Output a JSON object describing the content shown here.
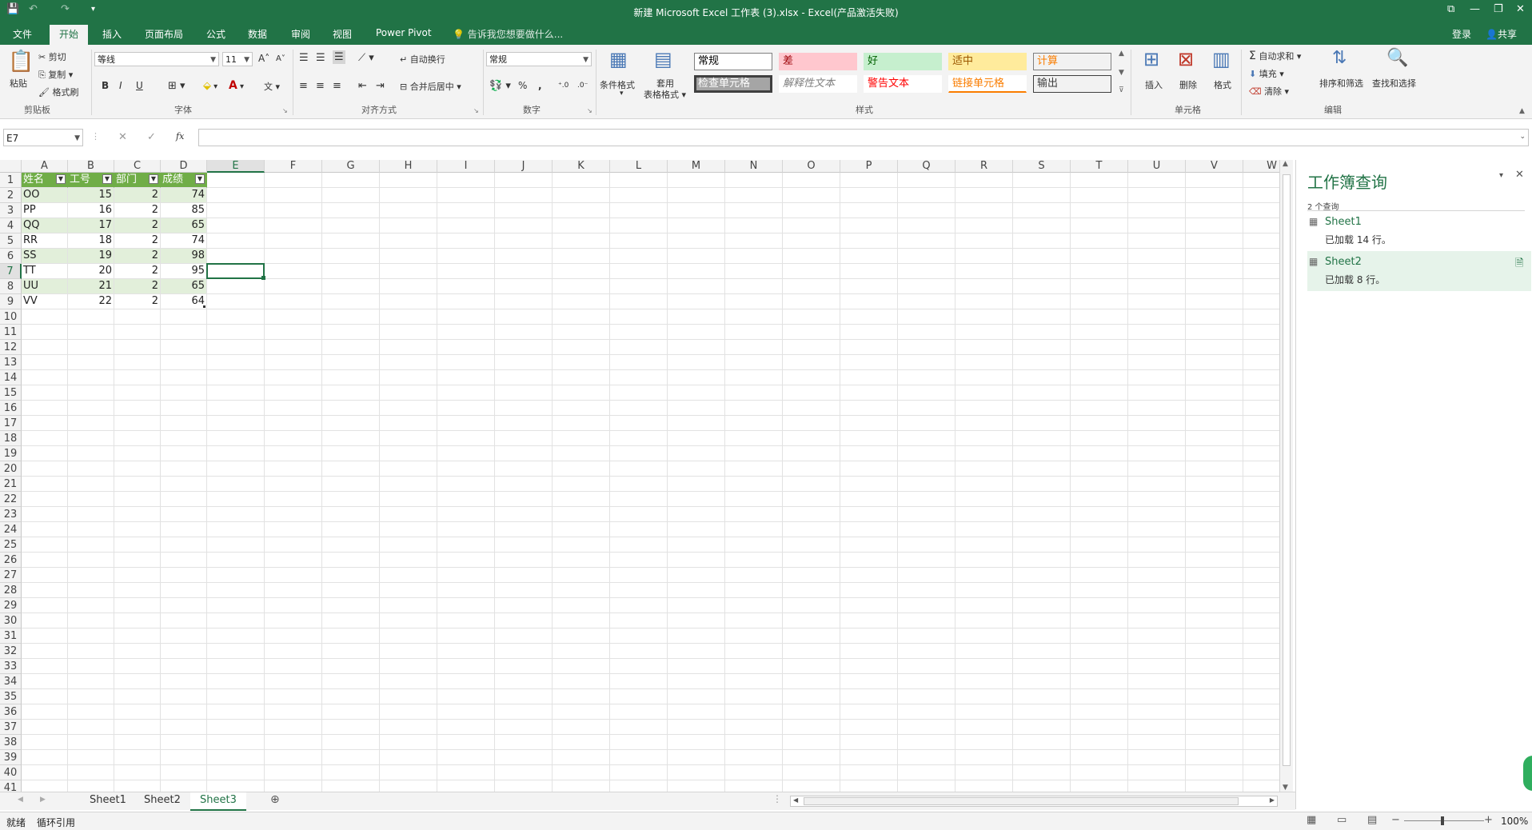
{
  "window": {
    "title": "新建 Microsoft Excel 工作表 (3).xlsx - Excel(产品激活失败)",
    "controls": [
      "⧉",
      "—",
      "❐",
      "✕"
    ]
  },
  "ribbon_tabs": [
    "文件",
    "开始",
    "插入",
    "页面布局",
    "公式",
    "数据",
    "审阅",
    "视图",
    "Power Pivot"
  ],
  "active_tab": "开始",
  "tell_me": "告诉我您想要做什么...",
  "account": {
    "login": "登录",
    "share": "共享"
  },
  "clipboard": {
    "paste": "粘贴",
    "cut": "剪切",
    "copy": "复制",
    "format_painter": "格式刷",
    "label": "剪贴板"
  },
  "font": {
    "name": "等线",
    "size": "11",
    "bold": "B",
    "italic": "I",
    "underline": "U",
    "label": "字体",
    "grow": "A",
    "shrink": "A"
  },
  "alignment": {
    "wrap": "自动换行",
    "merge": "合并后居中",
    "label": "对齐方式"
  },
  "number": {
    "format": "常规",
    "percent": "%",
    "comma": ",",
    "label": "数字"
  },
  "styles": {
    "cond_format": "条件格式",
    "table_format_1": "套用",
    "table_format_2": "表格格式",
    "label": "样式",
    "cells": [
      {
        "text": "常规",
        "bg": "#ffffff",
        "fg": "#000000",
        "border": "#7f7f7f"
      },
      {
        "text": "差",
        "bg": "#ffc7ce",
        "fg": "#9c0006",
        "border": "#ffc7ce"
      },
      {
        "text": "好",
        "bg": "#c6efce",
        "fg": "#006100",
        "border": "#c6efce"
      },
      {
        "text": "适中",
        "bg": "#ffeb9c",
        "fg": "#9c5700",
        "border": "#ffeb9c"
      },
      {
        "text": "计算",
        "bg": "#f2f2f2",
        "fg": "#fa7d00",
        "border": "#7f7f7f"
      },
      {
        "text": "检查单元格",
        "bg": "#a5a5a5",
        "fg": "#ffffff",
        "border": "#3f3f3f"
      },
      {
        "text": "解释性文本",
        "bg": "#ffffff",
        "fg": "#7f7f7f",
        "border": "#ffffff"
      },
      {
        "text": "警告文本",
        "bg": "#ffffff",
        "fg": "#ff0000",
        "border": "#ffffff"
      },
      {
        "text": "链接单元格",
        "bg": "#ffffff",
        "fg": "#fa7d00",
        "border": "#ffffff"
      },
      {
        "text": "输出",
        "bg": "#f2f2f2",
        "fg": "#3f3f3f",
        "border": "#3f3f3f"
      }
    ]
  },
  "cells_group": {
    "insert": "插入",
    "delete": "删除",
    "format": "格式",
    "label": "单元格"
  },
  "editing": {
    "autosum": "自动求和",
    "fill": "填充",
    "clear": "清除",
    "sort": "排序和筛选",
    "find": "查找和选择",
    "label": "编辑"
  },
  "formula_bar": {
    "name_box": "E7",
    "fx": "fx",
    "value": ""
  },
  "grid": {
    "columns": [
      "A",
      "B",
      "C",
      "D",
      "E",
      "F",
      "G",
      "H",
      "I",
      "J",
      "K",
      "L",
      "M",
      "N",
      "O",
      "P",
      "Q",
      "R",
      "S",
      "T",
      "U",
      "V",
      "W"
    ],
    "row_count": 41,
    "active_cell": "E7",
    "headers": [
      "姓名",
      "工号",
      "部门",
      "成绩"
    ],
    "rows": [
      [
        "OO",
        "15",
        "2",
        "74"
      ],
      [
        "PP",
        "16",
        "2",
        "85"
      ],
      [
        "QQ",
        "17",
        "2",
        "65"
      ],
      [
        "RR",
        "18",
        "2",
        "74"
      ],
      [
        "SS",
        "19",
        "2",
        "98"
      ],
      [
        "TT",
        "20",
        "2",
        "95"
      ],
      [
        "UU",
        "21",
        "2",
        "65"
      ],
      [
        "VV",
        "22",
        "2",
        "64"
      ]
    ]
  },
  "query_pane": {
    "title": "工作簿查询",
    "count": "2 个查询",
    "queries": [
      {
        "name": "Sheet1",
        "status": "已加载 14 行。"
      },
      {
        "name": "Sheet2",
        "status": "已加载 8 行。"
      }
    ]
  },
  "sheet_tabs": [
    "Sheet1",
    "Sheet2",
    "Sheet3"
  ],
  "active_sheet": "Sheet3",
  "status_bar": {
    "ready": "就绪",
    "circular": "循环引用",
    "zoom": "100%"
  },
  "colors": {
    "excel_green": "#217346",
    "table_header": "#70ad47",
    "table_band": "#e2efda"
  }
}
